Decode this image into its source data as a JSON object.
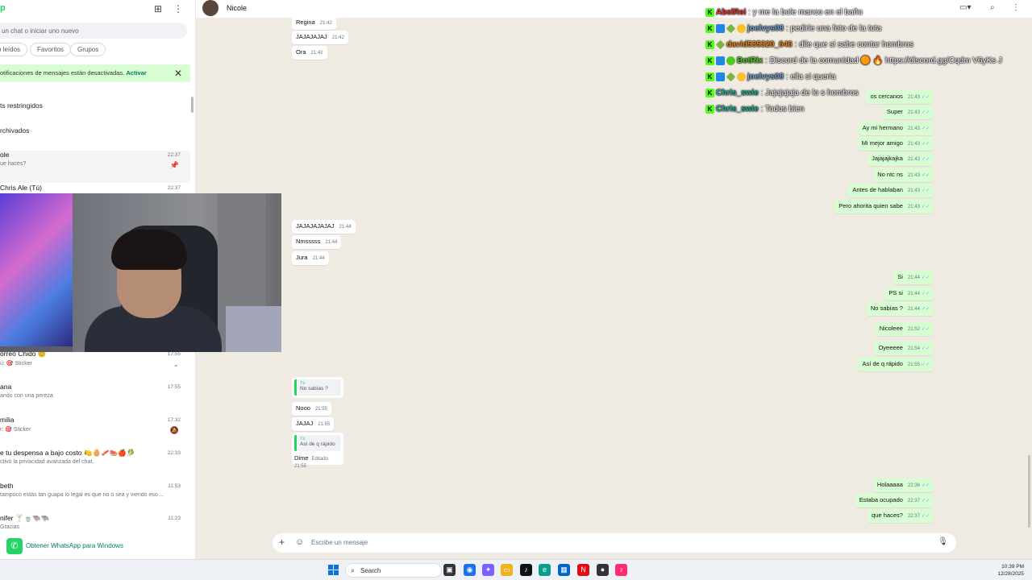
{
  "sidebar": {
    "logo": "p",
    "search_placeholder": "un chat o iniciar uno nuevo",
    "filters": [
      "o leídos",
      "Favoritos",
      "Grupos"
    ],
    "notice": {
      "text": "otificaciones de mensajes están desactivadas.",
      "action": "Activar"
    },
    "restricted": "ts restringidos",
    "archived": "rchivados",
    "chats": [
      {
        "name": "ole",
        "preview": "ue haces?",
        "time": "22:37",
        "icon": "pin-icon"
      },
      {
        "name": "Chris Ale (Tú)",
        "preview": "",
        "time": "22:37",
        "icon": ""
      },
      {
        "name": "orreo Chido 😊",
        "preview": "ú: 🎯 Sticker",
        "time": "17:55",
        "icon": "chevron-down-icon"
      },
      {
        "name": "ana",
        "preview": "ando con una pereza",
        "time": "17:55",
        "icon": ""
      },
      {
        "name": "milia",
        "preview": "r: 🎯 Sticker",
        "time": "17:32",
        "icon": "mute-icon"
      },
      {
        "name": "e tu despensa a bajo costo 🍋🥚🥓🍉🍎🥬",
        "preview": "ctivó la privacidad avanzada del chat.",
        "time": "22:33",
        "icon": ""
      },
      {
        "name": "beth",
        "preview": "tampoco estás tan guapa lo legal es que no o sea y viendo eso ...",
        "time": "11:53",
        "icon": ""
      },
      {
        "name": "nifer 🍸🍵🐃🐃",
        "preview": "Gracias",
        "time": "11:23",
        "icon": ""
      }
    ],
    "get_windows": "Obtener WhatsApp para Windows"
  },
  "header": {
    "contact_name": "Nicole"
  },
  "messages_in": [
    {
      "text": "Regina",
      "time": "21:42"
    },
    {
      "text": "JAJAJAJAJ",
      "time": "21:42"
    },
    {
      "text": "Ora",
      "time": "21:42"
    },
    {
      "text": "JAJAJAJAJAJ",
      "time": "21:44"
    },
    {
      "text": "Nmsssss",
      "time": "21:44"
    },
    {
      "text": "Jura",
      "time": "21:44"
    },
    {
      "text": "Nooo",
      "time": "21:55"
    },
    {
      "text": "JAJAJ",
      "time": "21:55"
    }
  ],
  "quotes_in": [
    {
      "quoted_name": "Tú",
      "quoted_text": "No sabías ?",
      "text": "",
      "time": ""
    },
    {
      "quoted_name": "Tú",
      "quoted_text": "Así de q rápido",
      "text": "Dime",
      "time": "Editado 21:55"
    }
  ],
  "messages_out": [
    {
      "text": "os cercanos",
      "time": "21:43"
    },
    {
      "text": "Super",
      "time": "21:43"
    },
    {
      "text": "Ay mi hermano",
      "time": "21:43"
    },
    {
      "text": "Mi mejor amigo",
      "time": "21:43"
    },
    {
      "text": "Jajajajkajka",
      "time": "21:43"
    },
    {
      "text": "No ntc ns",
      "time": "21:43"
    },
    {
      "text": "Antes de hablaban",
      "time": "21:43"
    },
    {
      "text": "Pero ahorita quien sabe",
      "time": "21:43"
    },
    {
      "text": "Si",
      "time": "21:44"
    },
    {
      "text": "PS si",
      "time": "21:44"
    },
    {
      "text": "No sabías ?",
      "time": "21:44"
    },
    {
      "text": "Nicoleee",
      "time": "21:52"
    },
    {
      "text": "Oyeeeee",
      "time": "21:54"
    },
    {
      "text": "Así de q rápido",
      "time": "21:55"
    },
    {
      "text": "Holaaaaa",
      "time": "22:36"
    },
    {
      "text": "Estaba ocupado",
      "time": "22:37"
    },
    {
      "text": "que haces?",
      "time": "22:37"
    }
  ],
  "composer": {
    "placeholder": "Escribe un mensaje"
  },
  "stream_chat": [
    {
      "user": "AbelRei",
      "msg": ": y me la bole manco en el baño",
      "color": "#e53935"
    },
    {
      "user": "joelvys08",
      "msg": ": pedirle una foto de la tota",
      "color": "#7aa7d9"
    },
    {
      "user": "david535320_646",
      "msg": ": dile que si sabe contar hombros",
      "color": "#e88a1a"
    },
    {
      "user": "BotRix",
      "msg": ": Discord de la comunidad 🟠 🔥 https://discord.gg/Cqdm V6yKs J",
      "color": "#53c628"
    },
    {
      "user": "joelvys08",
      "msg": ": ella si queria",
      "color": "#7aa7d9"
    },
    {
      "user": "Chris_swie",
      "msg": ": Jajajajaja de lo s hombros",
      "color": "#2bb59c"
    },
    {
      "user": "Chris_swie",
      "msg": ": Todos bien",
      "color": "#2bb59c"
    }
  ],
  "taskbar": {
    "search": "Search",
    "time": "10:39 PM",
    "date": "12/28/2025"
  }
}
